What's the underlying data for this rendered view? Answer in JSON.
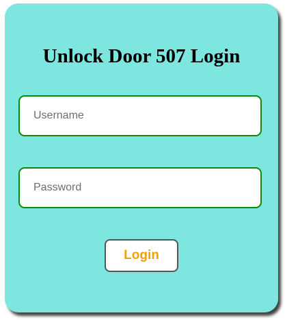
{
  "login_form": {
    "title": "Unlock Door 507 Login",
    "username": {
      "placeholder": "Username",
      "value": ""
    },
    "password": {
      "placeholder": "Password",
      "value": ""
    },
    "submit_label": "Login"
  },
  "colors": {
    "card_background": "#7de6de",
    "field_border": "#0a8a0a",
    "button_text": "#f0a00a",
    "button_border": "#555555"
  }
}
